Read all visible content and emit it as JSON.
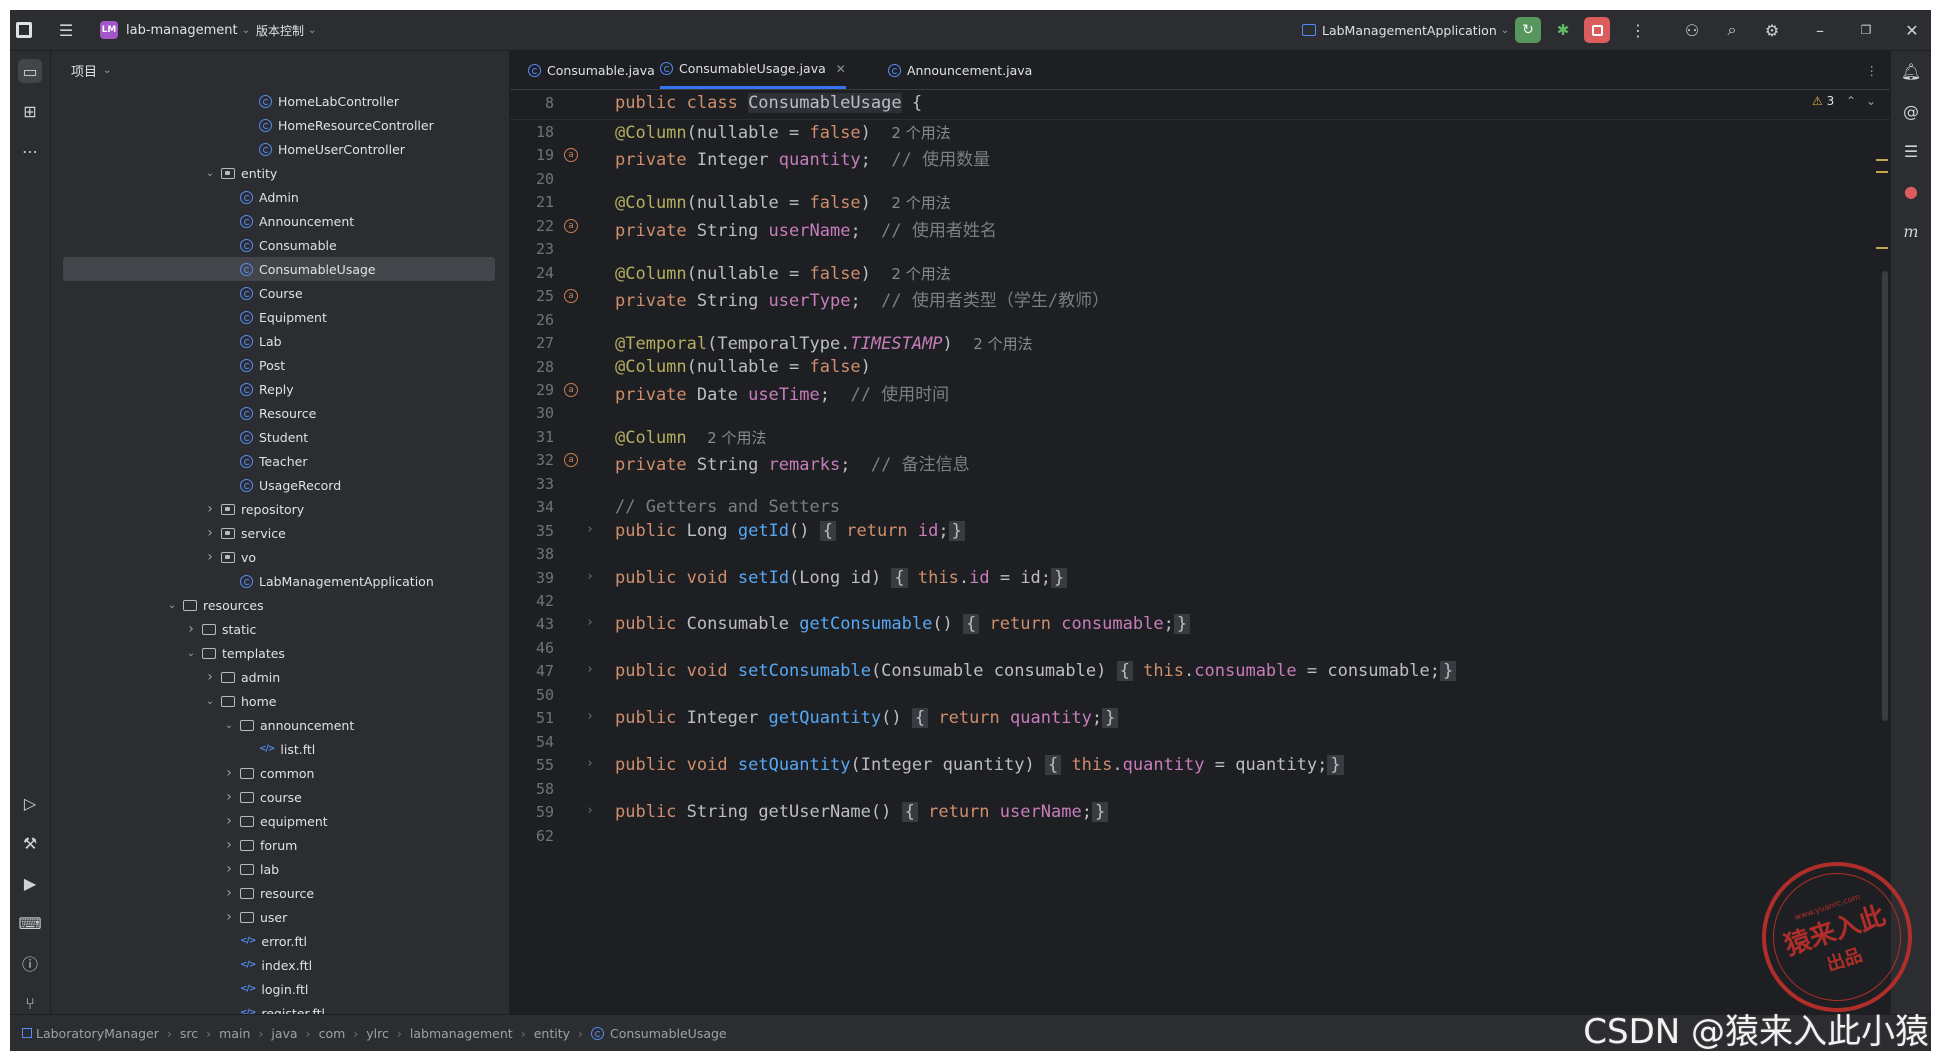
{
  "titlebar": {
    "project_badge": "LM",
    "project_name": "lab-management",
    "vcs_label": "版本控制",
    "run_config": "LabManagementApplication"
  },
  "project_panel": {
    "title": "项目",
    "tree": [
      {
        "label": "HomeLabController",
        "type": "class"
      },
      {
        "label": "HomeResourceController",
        "type": "class"
      },
      {
        "label": "HomeUserController",
        "type": "class"
      },
      {
        "label": "entity",
        "type": "package"
      },
      {
        "label": "Admin",
        "type": "class"
      },
      {
        "label": "Announcement",
        "type": "class"
      },
      {
        "label": "Consumable",
        "type": "class"
      },
      {
        "label": "ConsumableUsage",
        "type": "class"
      },
      {
        "label": "Course",
        "type": "class"
      },
      {
        "label": "Equipment",
        "type": "class"
      },
      {
        "label": "Lab",
        "type": "class"
      },
      {
        "label": "Post",
        "type": "class"
      },
      {
        "label": "Reply",
        "type": "class"
      },
      {
        "label": "Resource",
        "type": "class"
      },
      {
        "label": "Student",
        "type": "class"
      },
      {
        "label": "Teacher",
        "type": "class"
      },
      {
        "label": "UsageRecord",
        "type": "class"
      },
      {
        "label": "repository",
        "type": "package"
      },
      {
        "label": "service",
        "type": "package"
      },
      {
        "label": "vo",
        "type": "package"
      },
      {
        "label": "LabManagementApplication",
        "type": "class"
      },
      {
        "label": "resources",
        "type": "folder"
      },
      {
        "label": "static",
        "type": "folder"
      },
      {
        "label": "templates",
        "type": "folder"
      },
      {
        "label": "admin",
        "type": "folder"
      },
      {
        "label": "home",
        "type": "folder"
      },
      {
        "label": "announcement",
        "type": "folder"
      },
      {
        "label": "list.ftl",
        "type": "ftl"
      },
      {
        "label": "common",
        "type": "folder"
      },
      {
        "label": "course",
        "type": "folder"
      },
      {
        "label": "equipment",
        "type": "folder"
      },
      {
        "label": "forum",
        "type": "folder"
      },
      {
        "label": "lab",
        "type": "folder"
      },
      {
        "label": "resource",
        "type": "folder"
      },
      {
        "label": "user",
        "type": "folder"
      },
      {
        "label": "error.ftl",
        "type": "ftl"
      },
      {
        "label": "index.ftl",
        "type": "ftl"
      },
      {
        "label": "login.ftl",
        "type": "ftl"
      },
      {
        "label": "register.ftl",
        "type": "ftl"
      }
    ]
  },
  "tabs": [
    {
      "label": "Consumable.java"
    },
    {
      "label": "ConsumableUsage.java"
    },
    {
      "label": "Announcement.java"
    }
  ],
  "editor": {
    "warning_count": "3",
    "sticky_line": {
      "n": "8",
      "pre": "public class ",
      "name": "ConsumableUsage",
      "post": " {"
    },
    "lines": [
      {
        "n": "18"
      },
      {
        "n": "19"
      },
      {
        "n": "20"
      },
      {
        "n": "21"
      },
      {
        "n": "22"
      },
      {
        "n": "23"
      },
      {
        "n": "24"
      },
      {
        "n": "25"
      },
      {
        "n": "26"
      },
      {
        "n": "27"
      },
      {
        "n": "28"
      },
      {
        "n": "29"
      },
      {
        "n": "30"
      },
      {
        "n": "31"
      },
      {
        "n": "32"
      },
      {
        "n": "33"
      },
      {
        "n": "34"
      },
      {
        "n": "35"
      },
      {
        "n": "38"
      },
      {
        "n": "39"
      },
      {
        "n": "42"
      },
      {
        "n": "43"
      },
      {
        "n": "46"
      },
      {
        "n": "47"
      },
      {
        "n": "50"
      },
      {
        "n": "51"
      },
      {
        "n": "54"
      },
      {
        "n": "55"
      },
      {
        "n": "58"
      },
      {
        "n": "59"
      },
      {
        "n": "62"
      }
    ],
    "hint_usage": "2 个用法",
    "comments": {
      "quantity": "// 使用数量",
      "userName": "// 使用者姓名",
      "userType": "// 使用者类型（学生/教师）",
      "useTime": "// 使用时间",
      "remarks": "// 备注信息",
      "getters": "// Getters and Setters"
    }
  },
  "statusbar": {
    "breadcrumbs": [
      "LaboratoryManager",
      "src",
      "main",
      "java",
      "com",
      "ylrc",
      "labmanagement",
      "entity",
      "ConsumableUsage"
    ]
  },
  "watermark": {
    "stamp_main": "猿来入此",
    "stamp_sub": "出品",
    "stamp_url": "www.yuanrc.com",
    "csdn_text": "CSDN @猿来入此小猿"
  }
}
